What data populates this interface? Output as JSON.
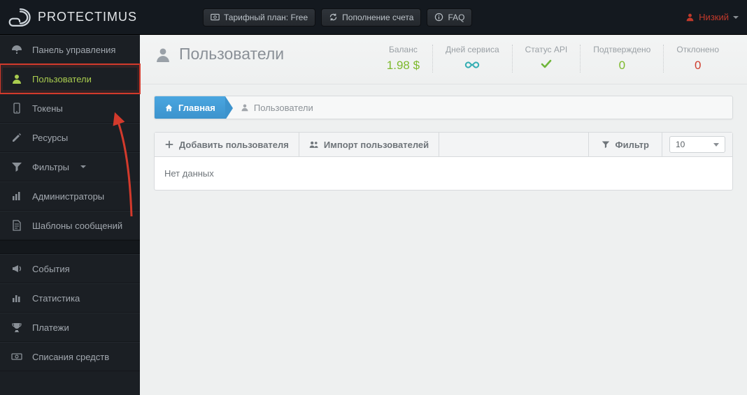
{
  "brand": "PROTECTIMUS",
  "topbar": {
    "plan_label": "Тарифный план: Free",
    "topup_label": "Пополнение счета",
    "faq_label": "FAQ",
    "user_label": "Низкий"
  },
  "sidebar": {
    "items": [
      {
        "label": "Панель управления",
        "icon": "dashboard"
      },
      {
        "label": "Пользователи",
        "icon": "user",
        "active": true,
        "highlighted": true
      },
      {
        "label": "Токены",
        "icon": "mobile"
      },
      {
        "label": "Ресурсы",
        "icon": "edit"
      },
      {
        "label": "Фильтры",
        "icon": "filter",
        "has_caret": true
      },
      {
        "label": "Администраторы",
        "icon": "bars"
      },
      {
        "label": "Шаблоны сообщений",
        "icon": "file"
      }
    ],
    "items2": [
      {
        "label": "События",
        "icon": "bullhorn"
      },
      {
        "label": "Статистика",
        "icon": "chart"
      },
      {
        "label": "Платежи",
        "icon": "trophy"
      },
      {
        "label": "Списания средств",
        "icon": "money"
      }
    ]
  },
  "page": {
    "title": "Пользователи"
  },
  "stats": {
    "balance_label": "Баланс",
    "balance_value": "1.98 $",
    "days_label": "Дней сервиса",
    "days_value": "∞",
    "api_label": "Статус API",
    "confirmed_label": "Подтверждено",
    "confirmed_value": "0",
    "declined_label": "Отклонено",
    "declined_value": "0"
  },
  "breadcrumb": {
    "home": "Главная",
    "current": "Пользователи"
  },
  "toolbar": {
    "add_label": "Добавить пользователя",
    "import_label": "Импорт пользователей",
    "filter_label": "Фильтр",
    "page_size": "10"
  },
  "table": {
    "empty_message": "Нет данных"
  }
}
